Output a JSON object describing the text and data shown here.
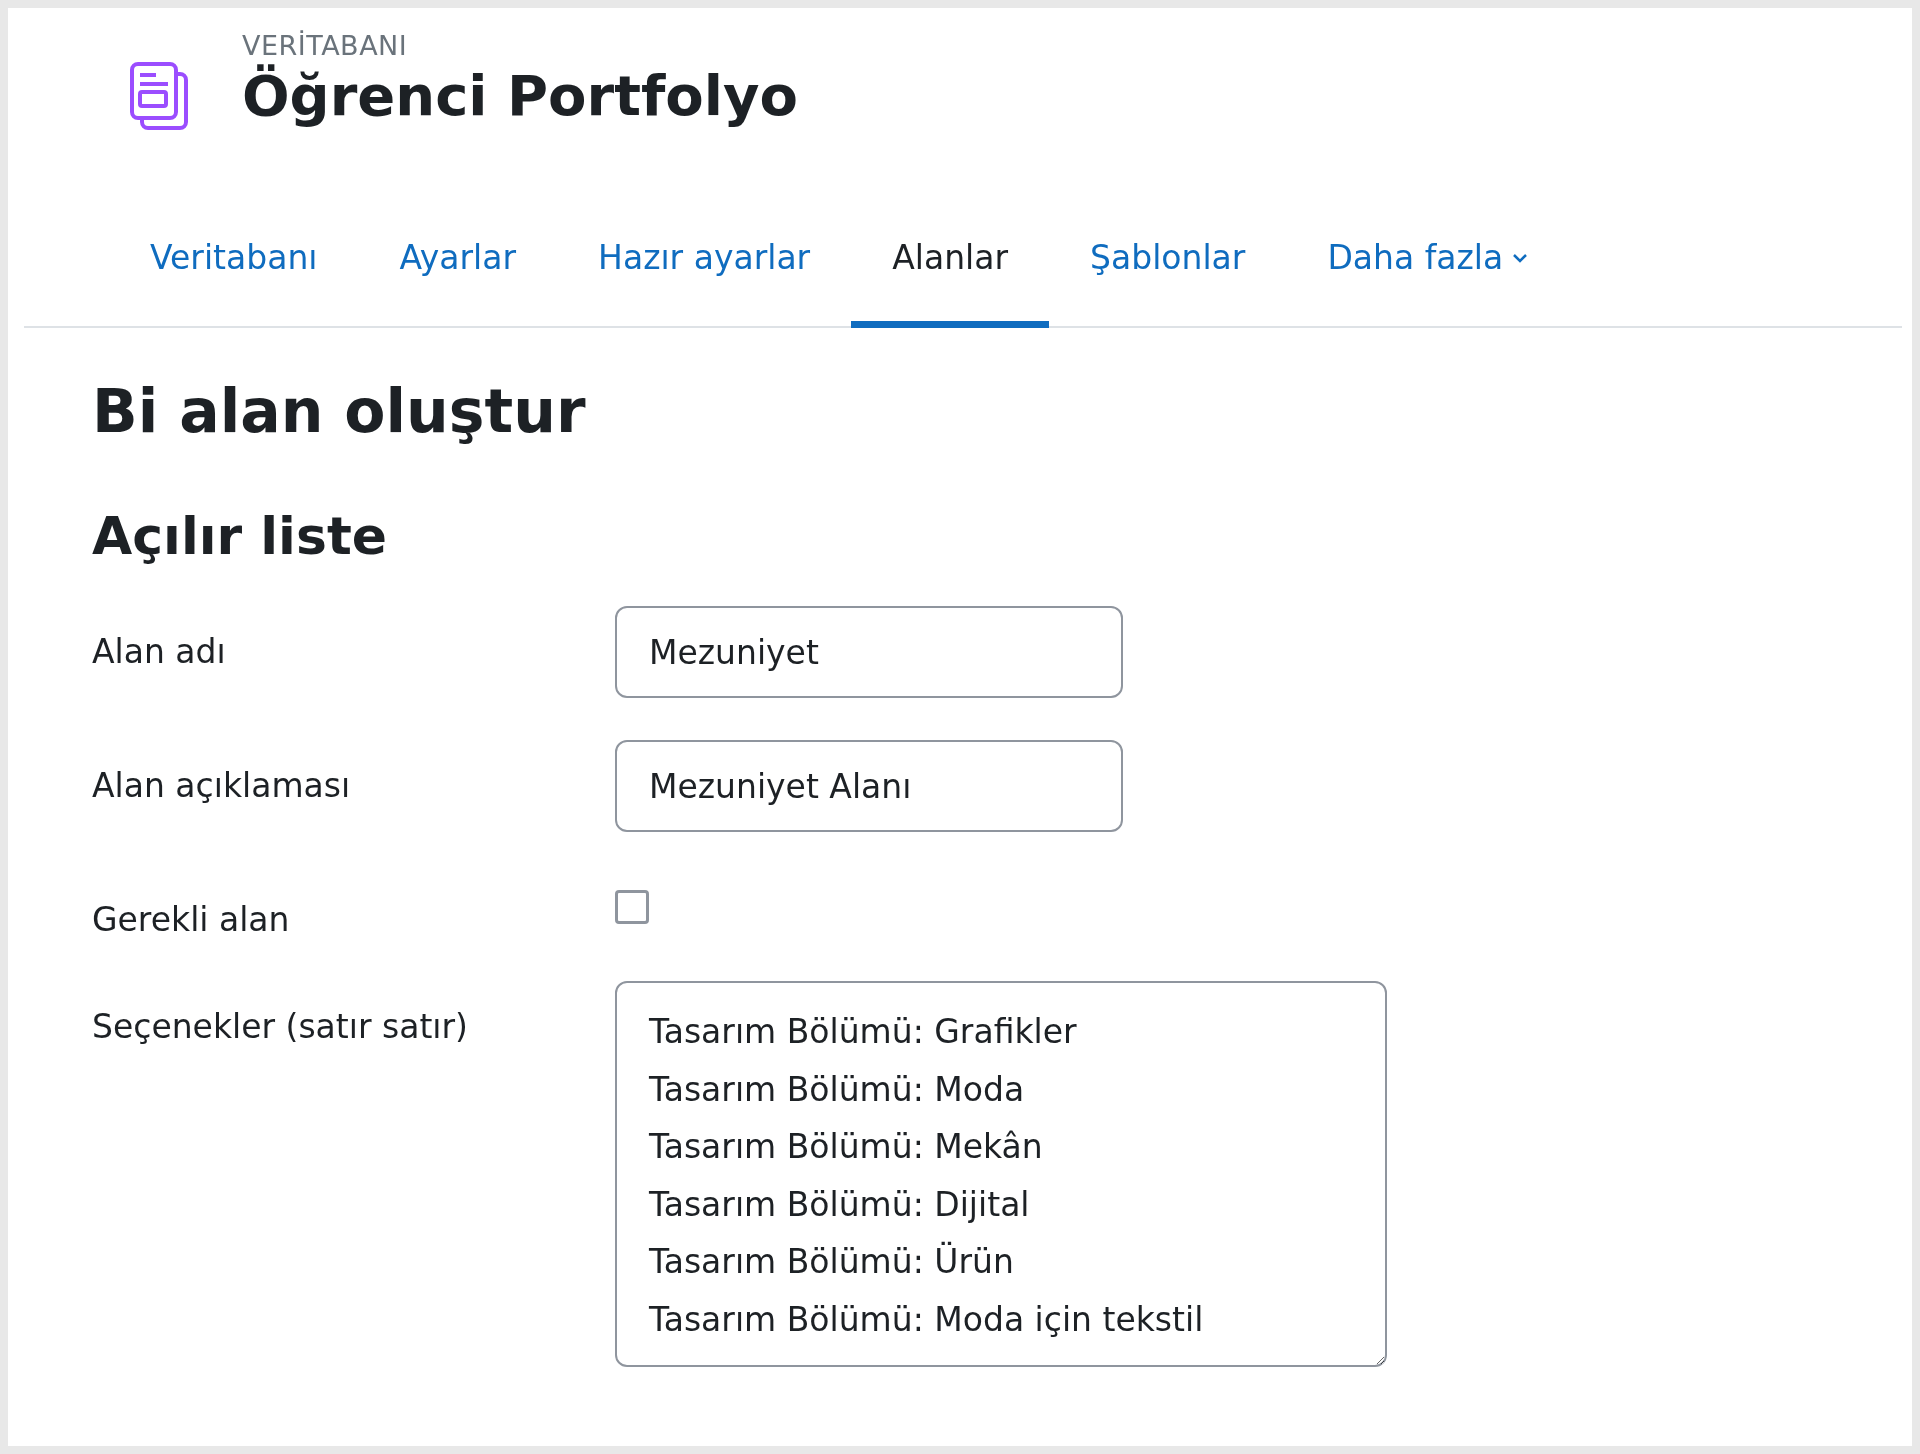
{
  "header": {
    "overline": "VERİTABANI",
    "title": "Öğrenci Portfolyo"
  },
  "tabs": [
    {
      "label": "Veritabanı",
      "selected": false,
      "dropdown": false
    },
    {
      "label": "Ayarlar",
      "selected": false,
      "dropdown": false
    },
    {
      "label": "Hazır ayarlar",
      "selected": false,
      "dropdown": false
    },
    {
      "label": "Alanlar",
      "selected": true,
      "dropdown": false
    },
    {
      "label": "Şablonlar",
      "selected": false,
      "dropdown": false
    },
    {
      "label": "Daha fazla",
      "selected": false,
      "dropdown": true
    }
  ],
  "page_heading": "Bi alan oluştur",
  "section_heading": "Açılır liste",
  "form": [
    {
      "kind": "text",
      "label": "Alan adı",
      "value": "Mezuniyet"
    },
    {
      "kind": "text",
      "label": "Alan açıklaması",
      "value": "Mezuniyet Alanı"
    },
    {
      "kind": "checkbox",
      "label": "Gerekli alan",
      "checked": false
    },
    {
      "kind": "textarea",
      "label": "Seçenekler (satır satır)",
      "lines": [
        "Tasarım Bölümü: Grafikler",
        "Tasarım Bölümü: Moda",
        "Tasarım Bölümü: Mekân",
        "Tasarım Bölümü: Dijital",
        "Tasarım Bölümü: Ürün",
        "Tasarım Bölümü: Moda için tekstil"
      ]
    }
  ]
}
